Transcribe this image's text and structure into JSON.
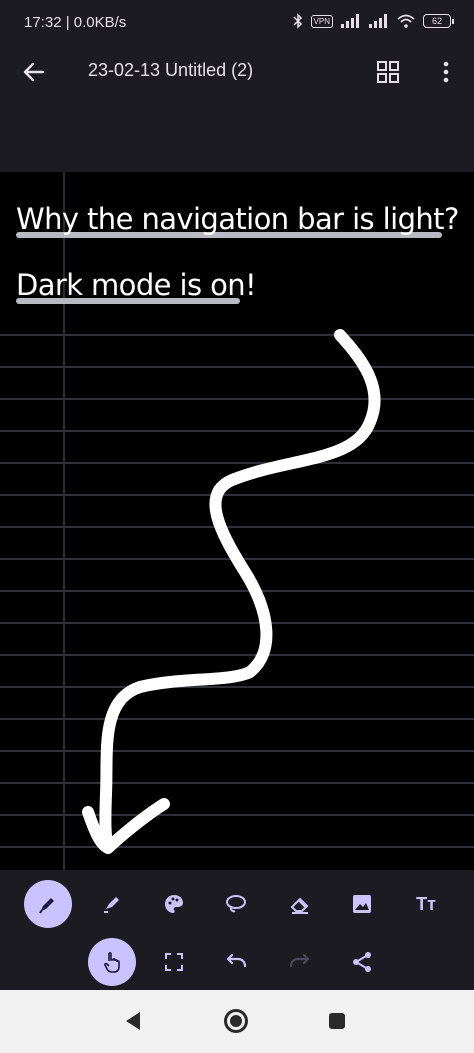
{
  "status_bar": {
    "time_speed": "17:32 | 0.0KB/s",
    "vpn_label": "VPN",
    "battery_level": "62",
    "icons": [
      "bluetooth-icon",
      "vpn-icon",
      "signal-icon",
      "signal-icon",
      "wifi-icon",
      "battery-icon"
    ]
  },
  "app_bar": {
    "title": "23-02-13 Untitled (2)",
    "icons": [
      "back-arrow-icon",
      "grid-view-icon",
      "more-vert-icon"
    ]
  },
  "canvas": {
    "text_lines": [
      "Why the navigation bar is light?",
      "Dark mode is on!"
    ],
    "drawing": "arrow-stroke"
  },
  "toolbar": {
    "row1": [
      "pen-icon",
      "highlighter-icon",
      "palette-icon",
      "lasso-icon",
      "eraser-icon",
      "image-icon",
      "text-icon"
    ],
    "row2": [
      "touch-icon",
      "select-frame-icon",
      "undo-icon",
      "redo-icon",
      "share-icon"
    ],
    "active_tools": [
      "pen-icon",
      "touch-icon"
    ],
    "text_tool_glyph": "Tт",
    "colors": {
      "active_bg": "#cbc3ff",
      "icon": "#cbc3ff",
      "icon_dark": "#1a1a3a"
    }
  },
  "nav_bar": {
    "buttons": [
      "nav-back-icon",
      "nav-home-icon",
      "nav-recents-icon"
    ]
  }
}
